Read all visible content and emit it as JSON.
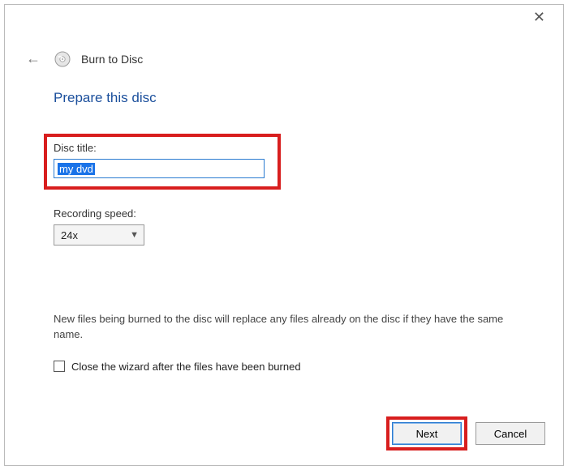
{
  "window": {
    "title": "Burn to Disc"
  },
  "main": {
    "heading": "Prepare this disc",
    "disc_title_label": "Disc title:",
    "disc_title_value": "my dvd",
    "recording_speed_label": "Recording speed:",
    "recording_speed_value": "24x",
    "note_text": "New files being burned to the disc will replace any files already on the disc if they have the same name.",
    "close_wizard_label": "Close the wizard after the files have been burned",
    "close_wizard_checked": false
  },
  "footer": {
    "next_label": "Next",
    "cancel_label": "Cancel"
  }
}
